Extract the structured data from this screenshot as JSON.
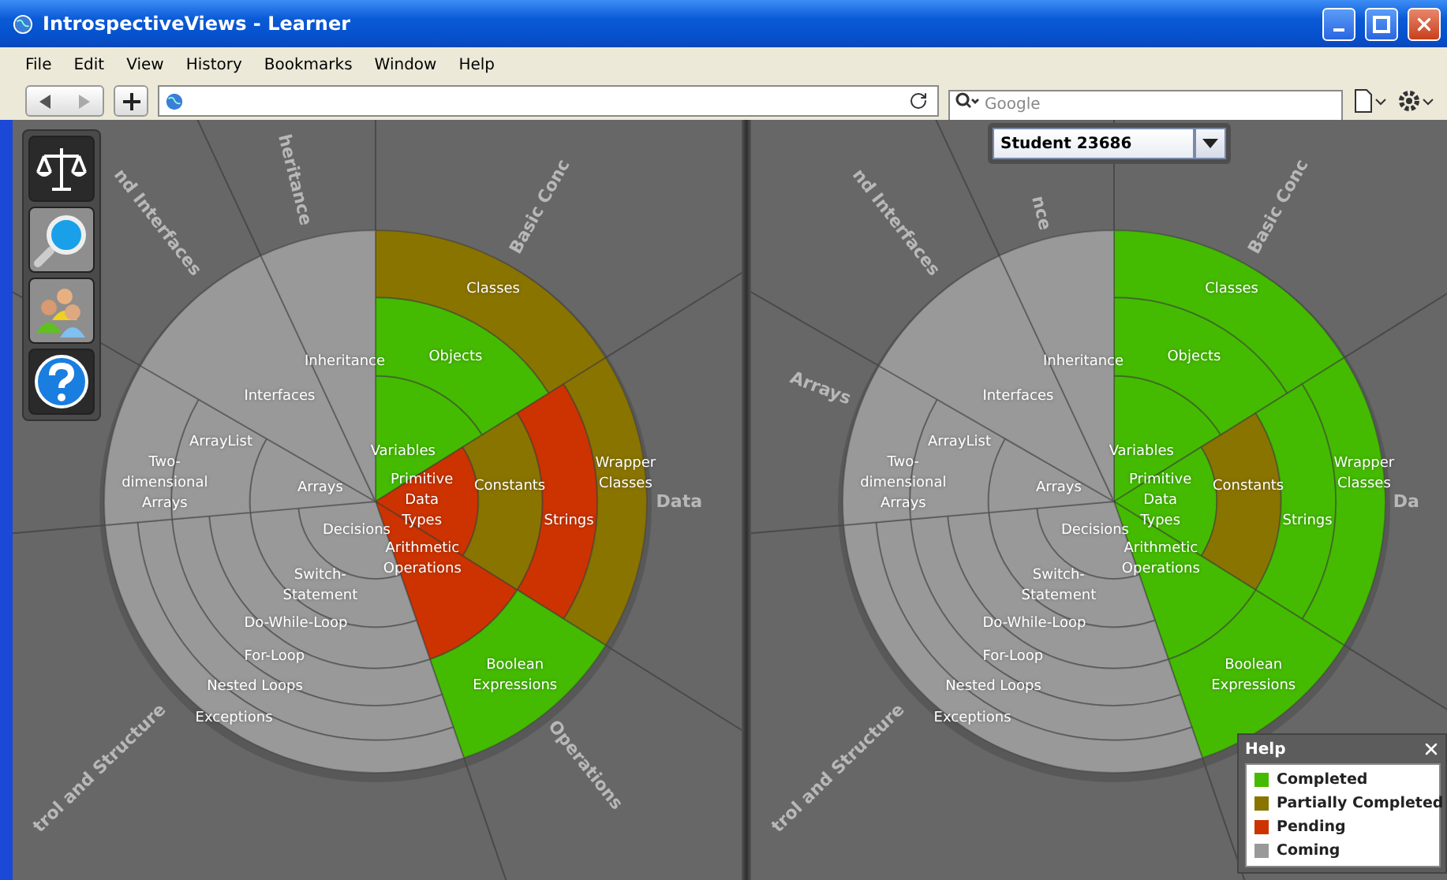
{
  "window": {
    "title": "IntrospectiveViews - Learner"
  },
  "menu": [
    "File",
    "Edit",
    "View",
    "History",
    "Bookmarks",
    "Window",
    "Help"
  ],
  "search": {
    "placeholder": "Google"
  },
  "student_selector": {
    "value": "Student 23686"
  },
  "legend": {
    "title": "Help",
    "items": [
      {
        "kind": "completed",
        "label": "Completed",
        "color": "#44bb00"
      },
      {
        "kind": "partial",
        "label": "Partially Completed",
        "color": "#8a7400"
      },
      {
        "kind": "pending",
        "label": "Pending",
        "color": "#cc3300"
      },
      {
        "kind": "coming",
        "label": "Coming",
        "color": "#999999"
      }
    ]
  },
  "charts": [
    {
      "sectors": [
        {
          "name": "Basic Conc",
          "topics": [
            {
              "label": "Variables",
              "kind": "completed"
            },
            {
              "label": "Objects",
              "kind": "completed"
            },
            {
              "label": "Classes",
              "kind": "partial"
            }
          ]
        },
        {
          "name": "Data",
          "topics": [
            {
              "label": "Primitive Data Types",
              "kind": "pending"
            },
            {
              "label": "Constants",
              "kind": "partial"
            },
            {
              "label": "Strings",
              "kind": "pending"
            },
            {
              "label": "Wrapper Classes",
              "kind": "partial"
            }
          ]
        },
        {
          "name": "Operations",
          "topics": [
            {
              "label": "Arithmetic Operations",
              "kind": "pending"
            },
            {
              "label": "Boolean Expressions",
              "kind": "completed"
            }
          ]
        },
        {
          "name": "trol and Structure",
          "topics": [
            {
              "label": "Decisions",
              "kind": "coming"
            },
            {
              "label": "Switch-Statement",
              "kind": "coming"
            },
            {
              "label": "Do-While-Loop",
              "kind": "coming"
            },
            {
              "label": "For-Loop",
              "kind": "coming"
            },
            {
              "label": "Nested Loops",
              "kind": "coming"
            },
            {
              "label": "Exceptions",
              "kind": "coming"
            }
          ]
        },
        {
          "topics": [
            {
              "label": "Arrays",
              "kind": "coming"
            },
            {
              "label": "ArrayList",
              "kind": "coming"
            },
            {
              "label": "Two-dimensional Arrays",
              "kind": "coming"
            }
          ]
        },
        {
          "name": "nd Interfaces",
          "topics": [
            {
              "label": "Interfaces",
              "kind": "coming"
            }
          ]
        },
        {
          "name": "heritance",
          "topics": [
            {
              "label": "Inheritance",
              "kind": "coming"
            }
          ]
        }
      ]
    },
    {
      "sectors": [
        {
          "name": "Basic Conc",
          "topics": [
            {
              "label": "Variables",
              "kind": "completed"
            },
            {
              "label": "Objects",
              "kind": "completed"
            },
            {
              "label": "Classes",
              "kind": "completed"
            }
          ]
        },
        {
          "name": "Da",
          "topics": [
            {
              "label": "Primitive Data Types",
              "kind": "completed"
            },
            {
              "label": "Constants",
              "kind": "partial"
            },
            {
              "label": "Strings",
              "kind": "completed"
            },
            {
              "label": "Wrapper Classes",
              "kind": "completed"
            }
          ]
        },
        {
          "topics": [
            {
              "label": "Arithmetic Operations",
              "kind": "completed"
            },
            {
              "label": "Boolean Expressions",
              "kind": "completed"
            }
          ]
        },
        {
          "name": "trol and Structure",
          "topics": [
            {
              "label": "Decisions",
              "kind": "coming"
            },
            {
              "label": "Switch-Statement",
              "kind": "coming"
            },
            {
              "label": "Do-While-Loop",
              "kind": "coming"
            },
            {
              "label": "For-Loop",
              "kind": "coming"
            },
            {
              "label": "Nested Loops",
              "kind": "coming"
            },
            {
              "label": "Exceptions",
              "kind": "coming"
            }
          ]
        },
        {
          "name": "Arrays",
          "topics": [
            {
              "label": "Arrays",
              "kind": "coming"
            },
            {
              "label": "ArrayList",
              "kind": "coming"
            },
            {
              "label": "Two-dimensional Arrays",
              "kind": "coming"
            }
          ]
        },
        {
          "name": "nd Interfaces",
          "topics": [
            {
              "label": "Interfaces",
              "kind": "coming"
            }
          ]
        },
        {
          "name": "nce",
          "topics": [
            {
              "label": "Inheritance",
              "kind": "coming"
            }
          ]
        }
      ]
    }
  ]
}
